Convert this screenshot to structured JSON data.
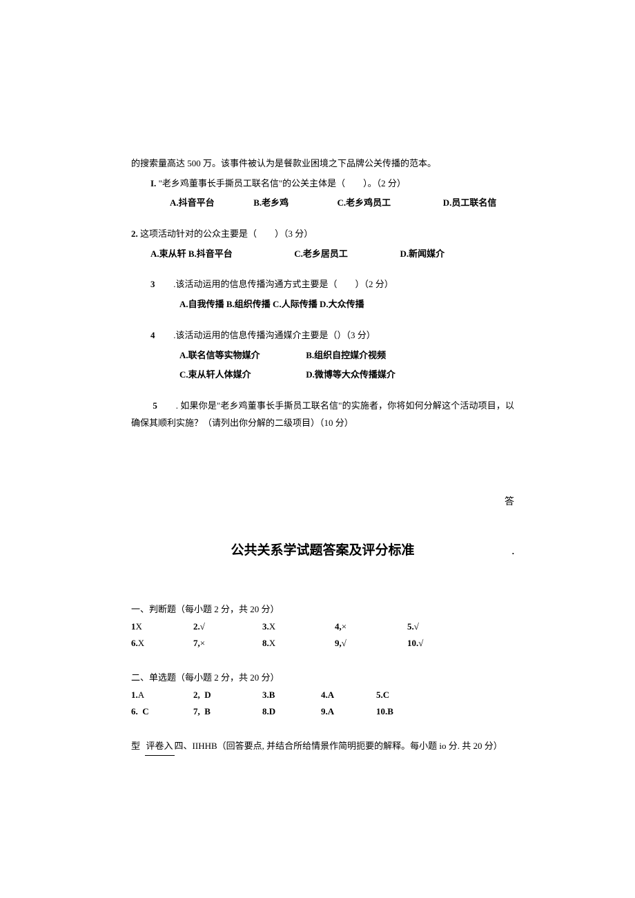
{
  "intro": "的搜索量高达 500 万。该事件被认为是餐款业困境之下品牌公关传播的范本。",
  "q1": {
    "stem_prefix": "I.",
    "stem": "\"老乡鸡董事长手撕员工联名信\"的公关主体是（　　）。（2 分）",
    "a": "A.抖音平台",
    "b": "B.老乡鸡",
    "c": "C.老乡鸡员工",
    "d": "D.员工联名信"
  },
  "q2": {
    "stem_prefix": "2.",
    "stem": "这项活动针对的公众主要是（　　）（3 分）",
    "a": "A.束从轩 B.抖音平台",
    "c": "C.老乡居员工",
    "d": "D.新闻媒介"
  },
  "q3": {
    "num": "3",
    "stem": ".该活动运用的信息传播沟通方式主要是（　　）（2 分）",
    "opts": "A.自我传播 B.组织传播 C.人际传播 D.大众传播"
  },
  "q4": {
    "num": "4",
    "stem": ".该活动运用的信息传播沟通媒介主要是（）（3 分）",
    "a": "A.联名信等实物媒介",
    "b": "B.组织自控媒介视频",
    "c": "C.束从轩人体媒介",
    "d": "D.微博等大众传播媒介"
  },
  "q5": {
    "num": "5",
    "stem": ". 如果你是\"老乡鸡董事长手撕员工联名信\"的实施者，你将如何分解这个活动项目，以确保其顺利实施？（请列出你分解的二级项目）（10 分）"
  },
  "right_char": "答",
  "answers_title": "公共关系学试题答案及评分标准",
  "dot": ".",
  "sec1": {
    "head": "一、判断题（每小题 2 分，共 20 分）",
    "r1": {
      "c1n": "1",
      "c1": "X",
      "c2n": "2.",
      "c2": "√",
      "c3n": "3.",
      "c3": "X",
      "c4n": "4,",
      "c4": "×",
      "c5n": "5.",
      "c5": "√"
    },
    "r2": {
      "c1n": "6.",
      "c1": "X",
      "c2n": "7,",
      "c2": "×",
      "c3n": "8.",
      "c3": "X",
      "c4n": "9,",
      "c4": "√",
      "c5n": "10.",
      "c5": "√"
    }
  },
  "sec2": {
    "head": "二、单选题（每小题 2 分，共 20 分）",
    "r1": {
      "c1n": "1.",
      "c1": "A",
      "c2n": "2,",
      "c2": "D",
      "c3n": "3.",
      "c3": "B",
      "c4n": "4.",
      "c4": "A",
      "c5n": "5.",
      "c5": "C"
    },
    "r2": {
      "c1n": "6.",
      "c1": "C",
      "c2n": "7,",
      "c2": "B",
      "c3n": "8.",
      "c3": "D",
      "c4n": "9.",
      "c4": "A",
      "c5n": "10.",
      "c5": "B"
    }
  },
  "footer": {
    "pre": "型",
    "ul": "评卷入",
    "post": "四、IIHHB（回答要点, 并结合所给情景作简明扼要的解释。每小题 io 分. 共 20 分）"
  }
}
